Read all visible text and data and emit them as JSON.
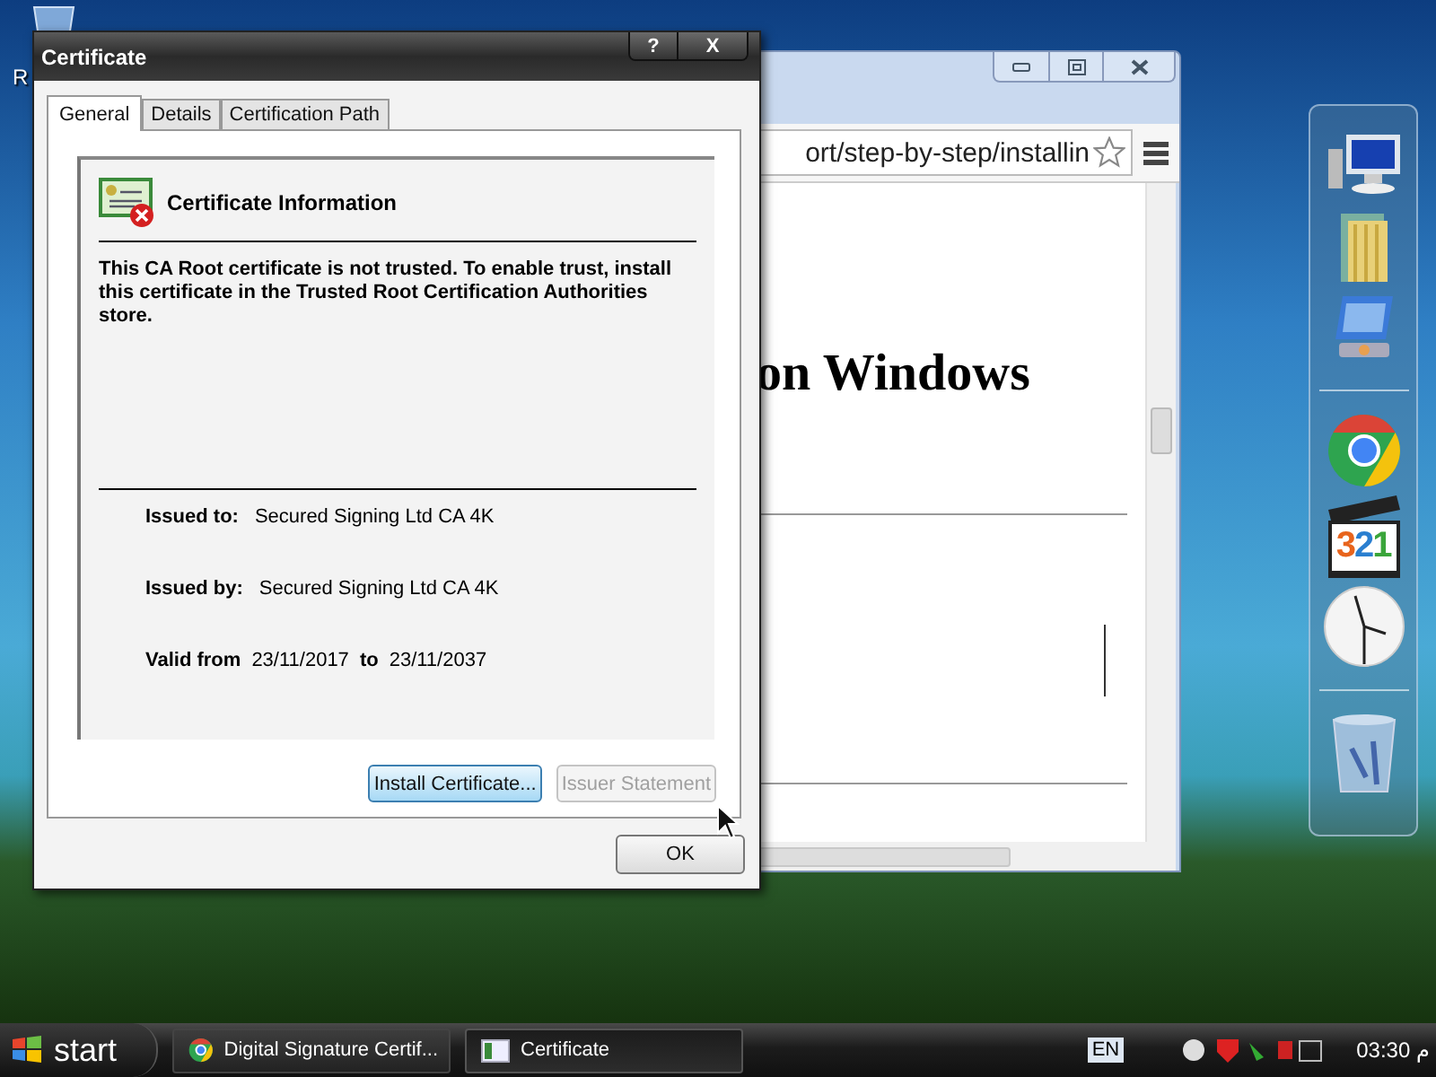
{
  "desktop": {
    "icons": [
      {
        "label": "R"
      }
    ]
  },
  "browser": {
    "address": "ort/step-by-step/installin",
    "heading": "on Windows"
  },
  "dock": {
    "media_label": "321"
  },
  "dialog": {
    "title": "Certificate",
    "help": "?",
    "close": "X",
    "tabs": [
      {
        "label": "General",
        "selected": true
      },
      {
        "label": "Details",
        "selected": false
      },
      {
        "label": "Certification Path",
        "selected": false
      }
    ],
    "info_title": "Certificate Information",
    "message": "This CA Root certificate is not trusted. To enable trust, install this certificate in the Trusted Root Certification Authorities store.",
    "fields": [
      {
        "label": "Issued to:",
        "value": "Secured Signing Ltd CA 4K"
      },
      {
        "label": "Issued by:",
        "value": "Secured Signing Ltd CA 4K"
      }
    ],
    "validity": {
      "label": "Valid from",
      "from": "23/11/2017",
      "to_label": "to",
      "to": "23/11/2037"
    },
    "buttons": [
      {
        "label": "Install Certificate...",
        "disabled": false,
        "focused": true
      },
      {
        "label": "Issuer Statement",
        "disabled": true,
        "focused": false
      }
    ],
    "ok": "OK"
  },
  "taskbar": {
    "start": "start",
    "tasks": [
      {
        "label": "Digital Signature Certif...",
        "kind": "browser",
        "selected": false
      },
      {
        "label": "Certificate",
        "kind": "certificate",
        "selected": true
      }
    ],
    "language": "EN",
    "clock": "03:30 م"
  }
}
